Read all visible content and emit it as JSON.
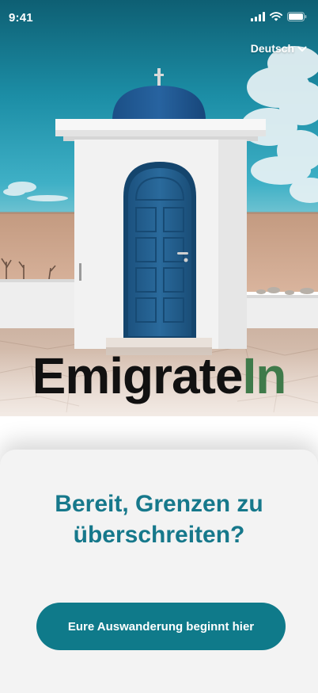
{
  "status_bar": {
    "time": "9:41",
    "icons": [
      "cellular-signal-icon",
      "wifi-icon",
      "battery-icon"
    ]
  },
  "language_selector": {
    "selected": "Deutsch",
    "icon": "chevron-down-icon"
  },
  "logo": {
    "main": "Emigrate",
    "accent": "In"
  },
  "sheet": {
    "headline_line1": "Bereit, Grenzen zu",
    "headline_line2": "überschreiten?",
    "cta_label": "Eure Auswanderung beginnt hier"
  },
  "colors": {
    "primary": "#0f7a8a",
    "headline": "#16788b",
    "logo_accent": "#3f7a4a",
    "sheet_background": "#f3f3f3"
  }
}
